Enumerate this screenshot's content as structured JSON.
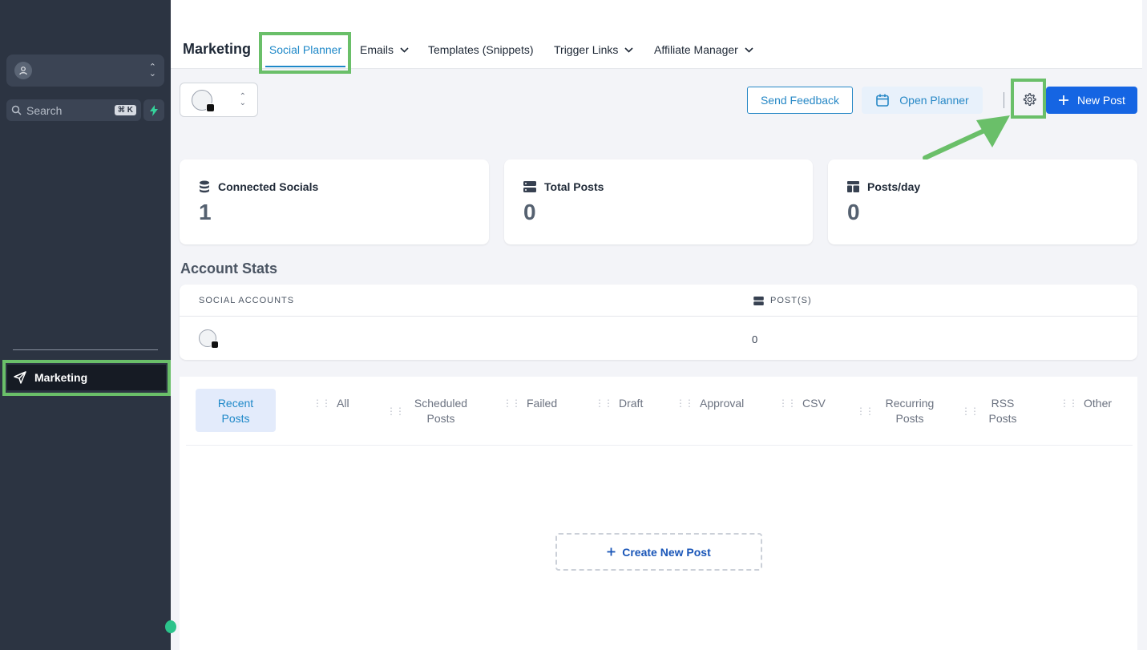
{
  "sidebar": {
    "search_label": "Search",
    "search_shortcut": "⌘ K",
    "nav_marketing": "Marketing"
  },
  "header": {
    "title": "Marketing",
    "tabs": [
      {
        "label": "Social Planner"
      },
      {
        "label": "Emails"
      },
      {
        "label": "Templates (Snippets)"
      },
      {
        "label": "Trigger Links"
      },
      {
        "label": "Affiliate Manager"
      }
    ]
  },
  "toolbar": {
    "send_feedback": "Send Feedback",
    "open_planner": "Open Planner",
    "new_post": "New Post"
  },
  "stats": [
    {
      "label": "Connected Socials",
      "value": "1",
      "icon": "database-icon"
    },
    {
      "label": "Total Posts",
      "value": "0",
      "icon": "server-icon"
    },
    {
      "label": "Posts/day",
      "value": "0",
      "icon": "layout-icon"
    }
  ],
  "account_stats": {
    "title": "Account Stats",
    "columns": [
      "SOCIAL ACCOUNTS",
      "POST(S)"
    ],
    "rows": [
      {
        "posts": "0"
      }
    ]
  },
  "post_tabs": [
    {
      "label": "Recent Posts",
      "active": true
    },
    {
      "label": "All"
    },
    {
      "label": "Scheduled Posts"
    },
    {
      "label": "Failed"
    },
    {
      "label": "Draft"
    },
    {
      "label": "Approval"
    },
    {
      "label": "CSV"
    },
    {
      "label": "Recurring Posts"
    },
    {
      "label": "RSS Posts"
    },
    {
      "label": "Other"
    }
  ],
  "create_new_post": "Create New Post",
  "colors": {
    "sidebar_bg": "#2c3442",
    "accent_blue": "#1565e3",
    "link_blue": "#1e88c8",
    "highlight_green": "#6abf69"
  }
}
